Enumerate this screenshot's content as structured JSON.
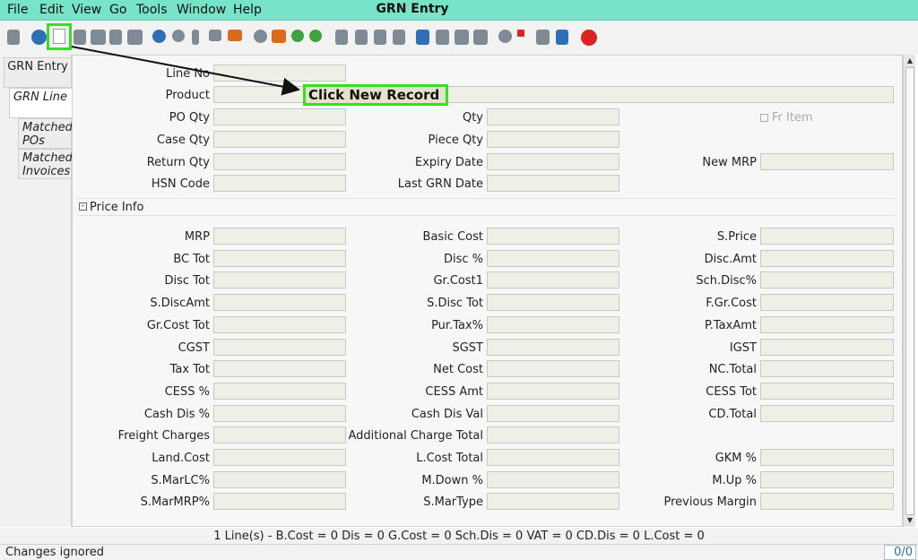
{
  "menubar": {
    "items": [
      "File",
      "Edit",
      "View",
      "Go",
      "Tools",
      "Window",
      "Help"
    ],
    "title": "GRN Entry"
  },
  "tabs": [
    "GRN Entry",
    "GRN Line",
    "Matched POs",
    "Matched Invoices"
  ],
  "fields": {
    "line_no": "Line No",
    "product": "Product",
    "po_qty": "PO Qty",
    "qty": "Qty",
    "fr_item": "Fr Item",
    "case_qty": "Case Qty",
    "piece_qty": "Piece Qty",
    "return_qty": "Return Qty",
    "expiry_date": "Expiry Date",
    "new_mrp": "New MRP",
    "hsn_code": "HSN Code",
    "last_grn_date": "Last GRN Date"
  },
  "section": {
    "label": "Price Info"
  },
  "price": {
    "col1": [
      "MRP",
      "BC Tot",
      "Disc Tot",
      "S.DiscAmt",
      "Gr.Cost Tot",
      "CGST",
      "Tax Tot",
      "CESS %",
      "Cash Dis %",
      "Freight Charges",
      "Land.Cost",
      "S.MarLC%",
      "S.MarMRP%"
    ],
    "col2": [
      "Basic Cost",
      "Disc %",
      "Gr.Cost1",
      "S.Disc Tot",
      "Pur.Tax%",
      "SGST",
      "Net Cost",
      "CESS Amt",
      "Cash Dis Val",
      "Additional Charge Total",
      "L.Cost Total",
      "M.Down %",
      "S.MarType"
    ],
    "col3": [
      "S.Price",
      "Disc.Amt",
      "Sch.Disc%",
      "F.Gr.Cost",
      "P.TaxAmt",
      "IGST",
      "NC.Total",
      "CESS Tot",
      "CD.Total",
      "",
      "GKM %",
      "M.Up %",
      "Previous Margin"
    ]
  },
  "summary": "1 Line(s) -   B.Cost = 0    Dis = 0    G.Cost = 0    Sch.Dis = 0    VAT = 0    CD.Dis = 0    L.Cost = 0",
  "status": {
    "message": "Changes ignored",
    "count": "0/0"
  },
  "annotation": {
    "text": "Click New Record"
  },
  "toolbar": {
    "icons": [
      "undo-icon",
      "help-icon",
      "new-record-icon",
      "copy-icon",
      "delete-icon",
      "delete-selection-icon",
      "save-icon",
      "refresh-icon",
      "find-icon",
      "attachment-icon",
      "chat-icon",
      "history-icon",
      "home-icon",
      "back-icon",
      "forward-icon",
      "first-icon",
      "previous-icon",
      "next-icon",
      "last-icon",
      "report-icon",
      "archive-icon",
      "print-icon",
      "print-preview-icon",
      "zoom-icon",
      "workflow-icon",
      "product-info-icon",
      "account-icon",
      "close-icon"
    ]
  }
}
